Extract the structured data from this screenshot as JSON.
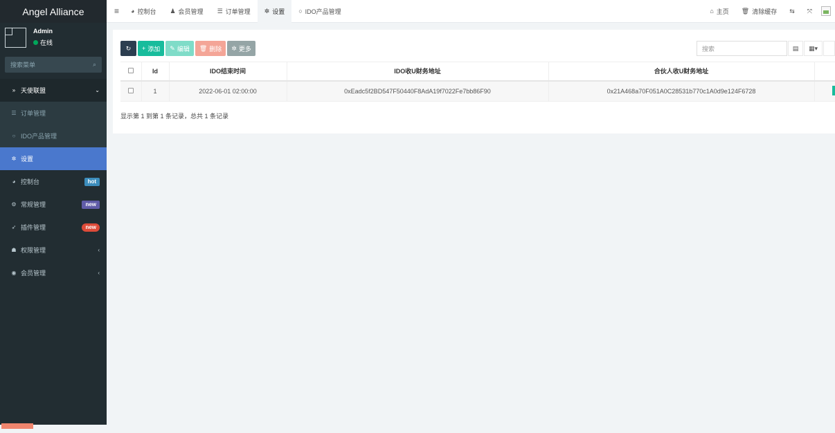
{
  "app": {
    "title": "Angel Alliance"
  },
  "user": {
    "name": "Admin",
    "status": "在线"
  },
  "sidebar": {
    "search_placeholder": "搜索菜单",
    "items": [
      {
        "label": "天使联盟",
        "icon": "angle-double-right-icon"
      },
      {
        "label": "订单管理",
        "icon": "list-icon"
      },
      {
        "label": "IDO产品管理",
        "icon": "circle-o-icon"
      },
      {
        "label": "设置",
        "icon": "gear-icon"
      },
      {
        "label": "控制台",
        "icon": "dashboard-icon",
        "badge": "hot"
      },
      {
        "label": "常规管理",
        "icon": "cogs-icon",
        "badge": "new"
      },
      {
        "label": "插件管理",
        "icon": "rocket-icon",
        "badge": "new"
      },
      {
        "label": "权限管理",
        "icon": "group-icon"
      },
      {
        "label": "会员管理",
        "icon": "user-circle-icon"
      }
    ]
  },
  "topbar": {
    "tabs": [
      {
        "label": "控制台",
        "icon": "dashboard-icon"
      },
      {
        "label": "会员管理",
        "icon": "user-icon"
      },
      {
        "label": "订单管理",
        "icon": "list-icon"
      },
      {
        "label": "设置",
        "icon": "gear-icon"
      },
      {
        "label": "IDO产品管理",
        "icon": "circle-o-icon"
      }
    ],
    "home_label": "主页",
    "clear_cache_label": "清除缓存"
  },
  "toolbar": {
    "add_label": "添加",
    "edit_label": "编辑",
    "delete_label": "删除",
    "more_label": "更多",
    "search_placeholder": "搜索"
  },
  "table": {
    "columns": [
      "Id",
      "IDO结束时间",
      "IDO收U财务地址",
      "合伙人收U财务地址"
    ],
    "rows": [
      [
        "1",
        "2022-06-01 02:00:00",
        "0xEadc5f2BD547F50440F8AdA19f7022Fe7bb86F90",
        "0x21A468a70F051A0C28531b770c1A0d9e124F6728"
      ]
    ],
    "footer": "显示第 1 到第 1 条记录，总共 1 条记录"
  },
  "colors": {
    "sidebar_bg": "#222d32",
    "active_item": "#4a78cd",
    "accent_green": "#18bc9c",
    "badge_hot": "#3c8dbc",
    "badge_new": "#605ca8",
    "badge_new_red": "#dd4b39"
  }
}
